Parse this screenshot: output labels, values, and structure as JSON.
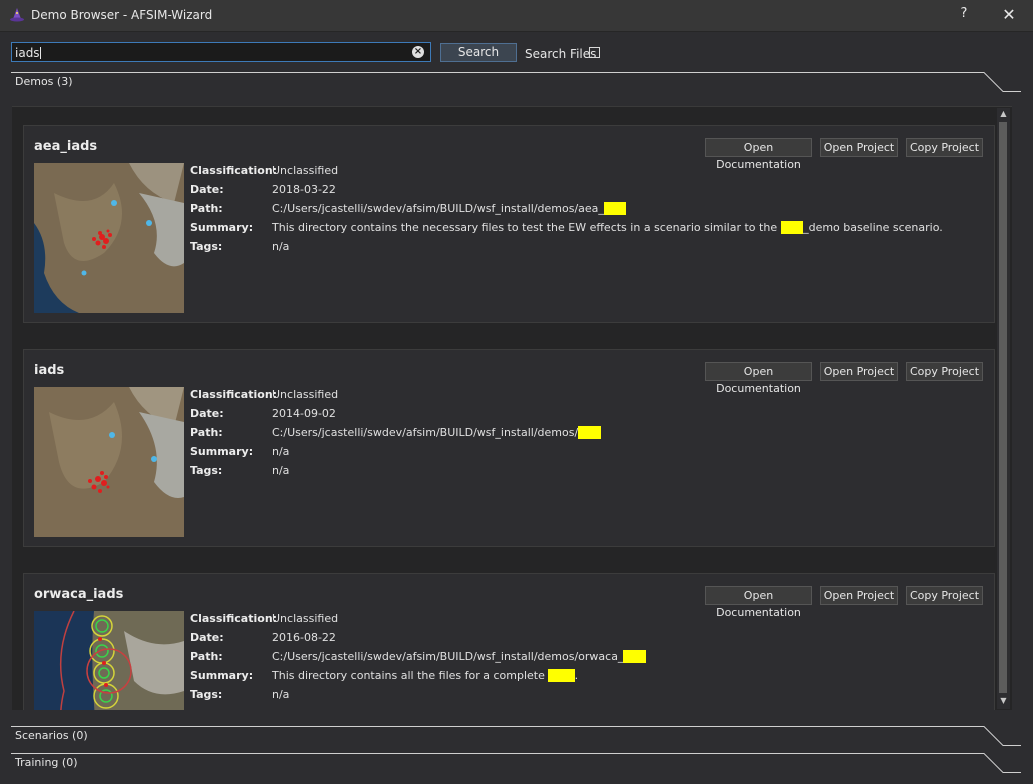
{
  "window": {
    "title": "Demo Browser - AFSIM-Wizard",
    "help": "?",
    "close": "✕"
  },
  "search": {
    "value": "iads",
    "button": "Search",
    "files_label": "Search Files",
    "files_checked": false
  },
  "sections": {
    "demos": "Demos (3)",
    "scenarios": "Scenarios (0)",
    "training": "Training (0)"
  },
  "labels": {
    "classification": "Classification:",
    "date": "Date:",
    "path": "Path:",
    "summary": "Summary:",
    "tags": "Tags:",
    "open_doc": "Open Documentation",
    "open_proj": "Open Project",
    "copy_proj": "Copy Project"
  },
  "demos": [
    {
      "name": "aea_iads",
      "classification": "Unclassified",
      "date": "2018-03-22",
      "path_prefix": "C:/Users/jcastelli/swdev/afsim/BUILD/wsf_install/demos/aea_",
      "path_hl": "iads",
      "summary_a": "This directory contains the necessary files to test the EW effects in a scenario similar to the ",
      "summary_hl": "iads",
      "summary_b": "_demo baseline scenario.",
      "tags": "n/a"
    },
    {
      "name": "iads",
      "classification": "Unclassified",
      "date": "2014-09-02",
      "path_prefix": "C:/Users/jcastelli/swdev/afsim/BUILD/wsf_install/demos/",
      "path_hl": "iads",
      "summary": "n/a",
      "tags": "n/a"
    },
    {
      "name": "orwaca_iads",
      "classification": "Unclassified",
      "date": "2016-08-22",
      "path_prefix": "C:/Users/jcastelli/swdev/afsim/BUILD/wsf_install/demos/orwaca_",
      "path_hl": "iads",
      "summary_a": "This directory contains all the files for a complete ",
      "summary_hl": "IADS",
      "summary_b": ".",
      "tags": "n/a"
    }
  ],
  "colors": {
    "highlight": "#ffff00",
    "accent": "#3d7ab8"
  }
}
